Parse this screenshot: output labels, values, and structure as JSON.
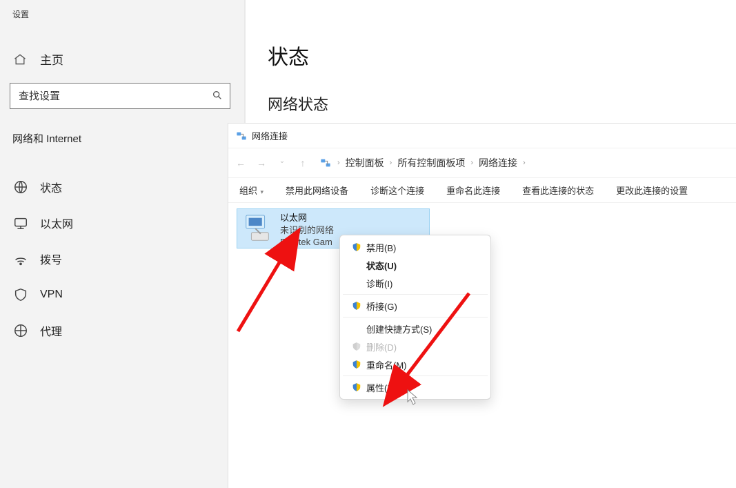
{
  "settings": {
    "title": "设置",
    "home_label": "主页",
    "search_placeholder": "查找设置",
    "section_label": "网络和 Internet",
    "nav": [
      {
        "label": "状态"
      },
      {
        "label": "以太网"
      },
      {
        "label": "拨号"
      },
      {
        "label": "VPN"
      },
      {
        "label": "代理"
      }
    ],
    "main_title": "状态",
    "main_subtitle": "网络状态"
  },
  "explorer": {
    "window_title": "网络连接",
    "breadcrumb": [
      "控制面板",
      "所有控制面板项",
      "网络连接"
    ],
    "toolbar": {
      "organize": "组织",
      "items": [
        "禁用此网络设备",
        "诊断这个连接",
        "重命名此连接",
        "查看此连接的状态",
        "更改此连接的设置"
      ]
    },
    "adapter": {
      "name": "以太网",
      "status": "未识别的网络",
      "device": "Realtek Gam"
    }
  },
  "context_menu": {
    "disable": "禁用(B)",
    "status": "状态(U)",
    "diagnose": "诊断(I)",
    "bridge": "桥接(G)",
    "shortcut": "创建快捷方式(S)",
    "delete": "删除(D)",
    "rename": "重命名(M)",
    "properties": "属性(R)"
  }
}
